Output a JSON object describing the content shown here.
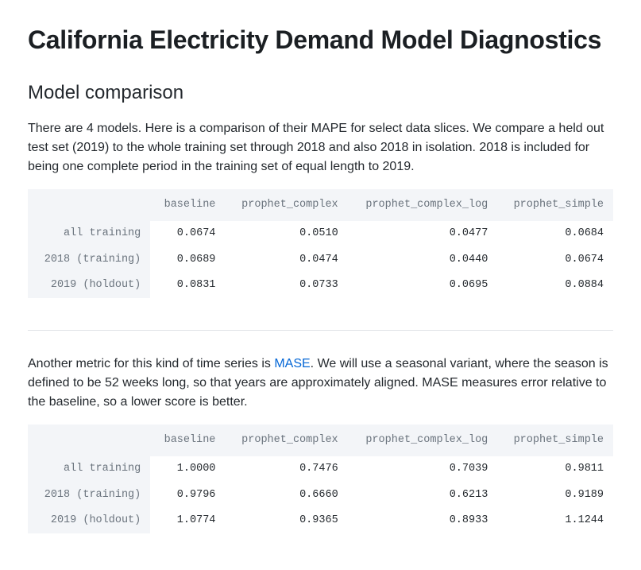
{
  "title": "California Electricity Demand Model Diagnostics",
  "section_heading": "Model comparison",
  "intro_paragraph": "There are 4 models. Here is a comparison of their MAPE for select data slices. We compare a held out test set (2019) to the whole training set through 2018 and also 2018 in isolation. 2018 is included for being one complete period in the training set of equal length to 2019.",
  "mase_paragraph_prefix": "Another metric for this kind of time series is ",
  "mase_link_text": "MASE",
  "mase_paragraph_suffix": ". We will use a seasonal variant, where the season is defined to be 52 weeks long, so that years are approximately aligned. MASE measures error relative to the baseline, so a lower score is better.",
  "columns": [
    "baseline",
    "prophet_complex",
    "prophet_complex_log",
    "prophet_simple"
  ],
  "row_labels": [
    "all training",
    "2018 (training)",
    "2019 (holdout)"
  ],
  "mape_table": [
    [
      "0.0674",
      "0.0510",
      "0.0477",
      "0.0684"
    ],
    [
      "0.0689",
      "0.0474",
      "0.0440",
      "0.0674"
    ],
    [
      "0.0831",
      "0.0733",
      "0.0695",
      "0.0884"
    ]
  ],
  "mase_table": [
    [
      "1.0000",
      "0.7476",
      "0.7039",
      "0.9811"
    ],
    [
      "0.9796",
      "0.6660",
      "0.6213",
      "0.9189"
    ],
    [
      "1.0774",
      "0.9365",
      "0.8933",
      "1.1244"
    ]
  ]
}
